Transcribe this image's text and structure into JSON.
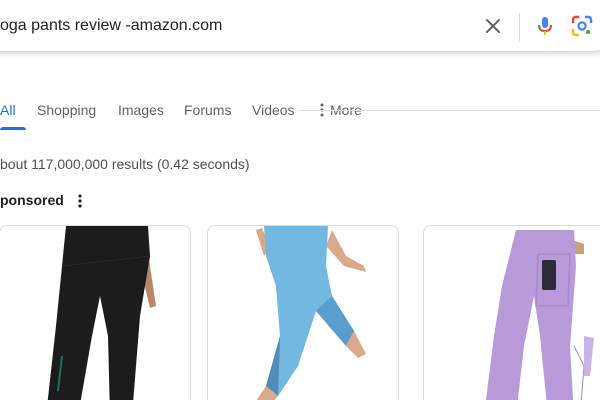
{
  "search": {
    "query": "oga pants review -amazon.com",
    "clear_icon": "close-icon",
    "voice_icon": "microphone-icon",
    "lens_icon": "google-lens-icon"
  },
  "tabs": [
    {
      "label": "All",
      "active": true
    },
    {
      "label": "Shopping",
      "active": false
    },
    {
      "label": "Images",
      "active": false
    },
    {
      "label": "Forums",
      "active": false
    },
    {
      "label": "Videos",
      "active": false
    },
    {
      "label": "More",
      "active": false,
      "icon": "vertical-dots-icon"
    }
  ],
  "results": {
    "stats": "bout 117,000,000 results (0.42 seconds)"
  },
  "ads": {
    "sponsored_label": "ponsored",
    "products": [
      {
        "name": "black leggings",
        "color": "#1c1c1c"
      },
      {
        "name": "blue leggings",
        "color": "#6fb3dc"
      },
      {
        "name": "purple leggings",
        "color": "#b79ad8"
      }
    ]
  },
  "colors": {
    "accent": "#1a73e8",
    "text": "#202124",
    "muted": "#5f6368",
    "border": "#dadce0"
  }
}
